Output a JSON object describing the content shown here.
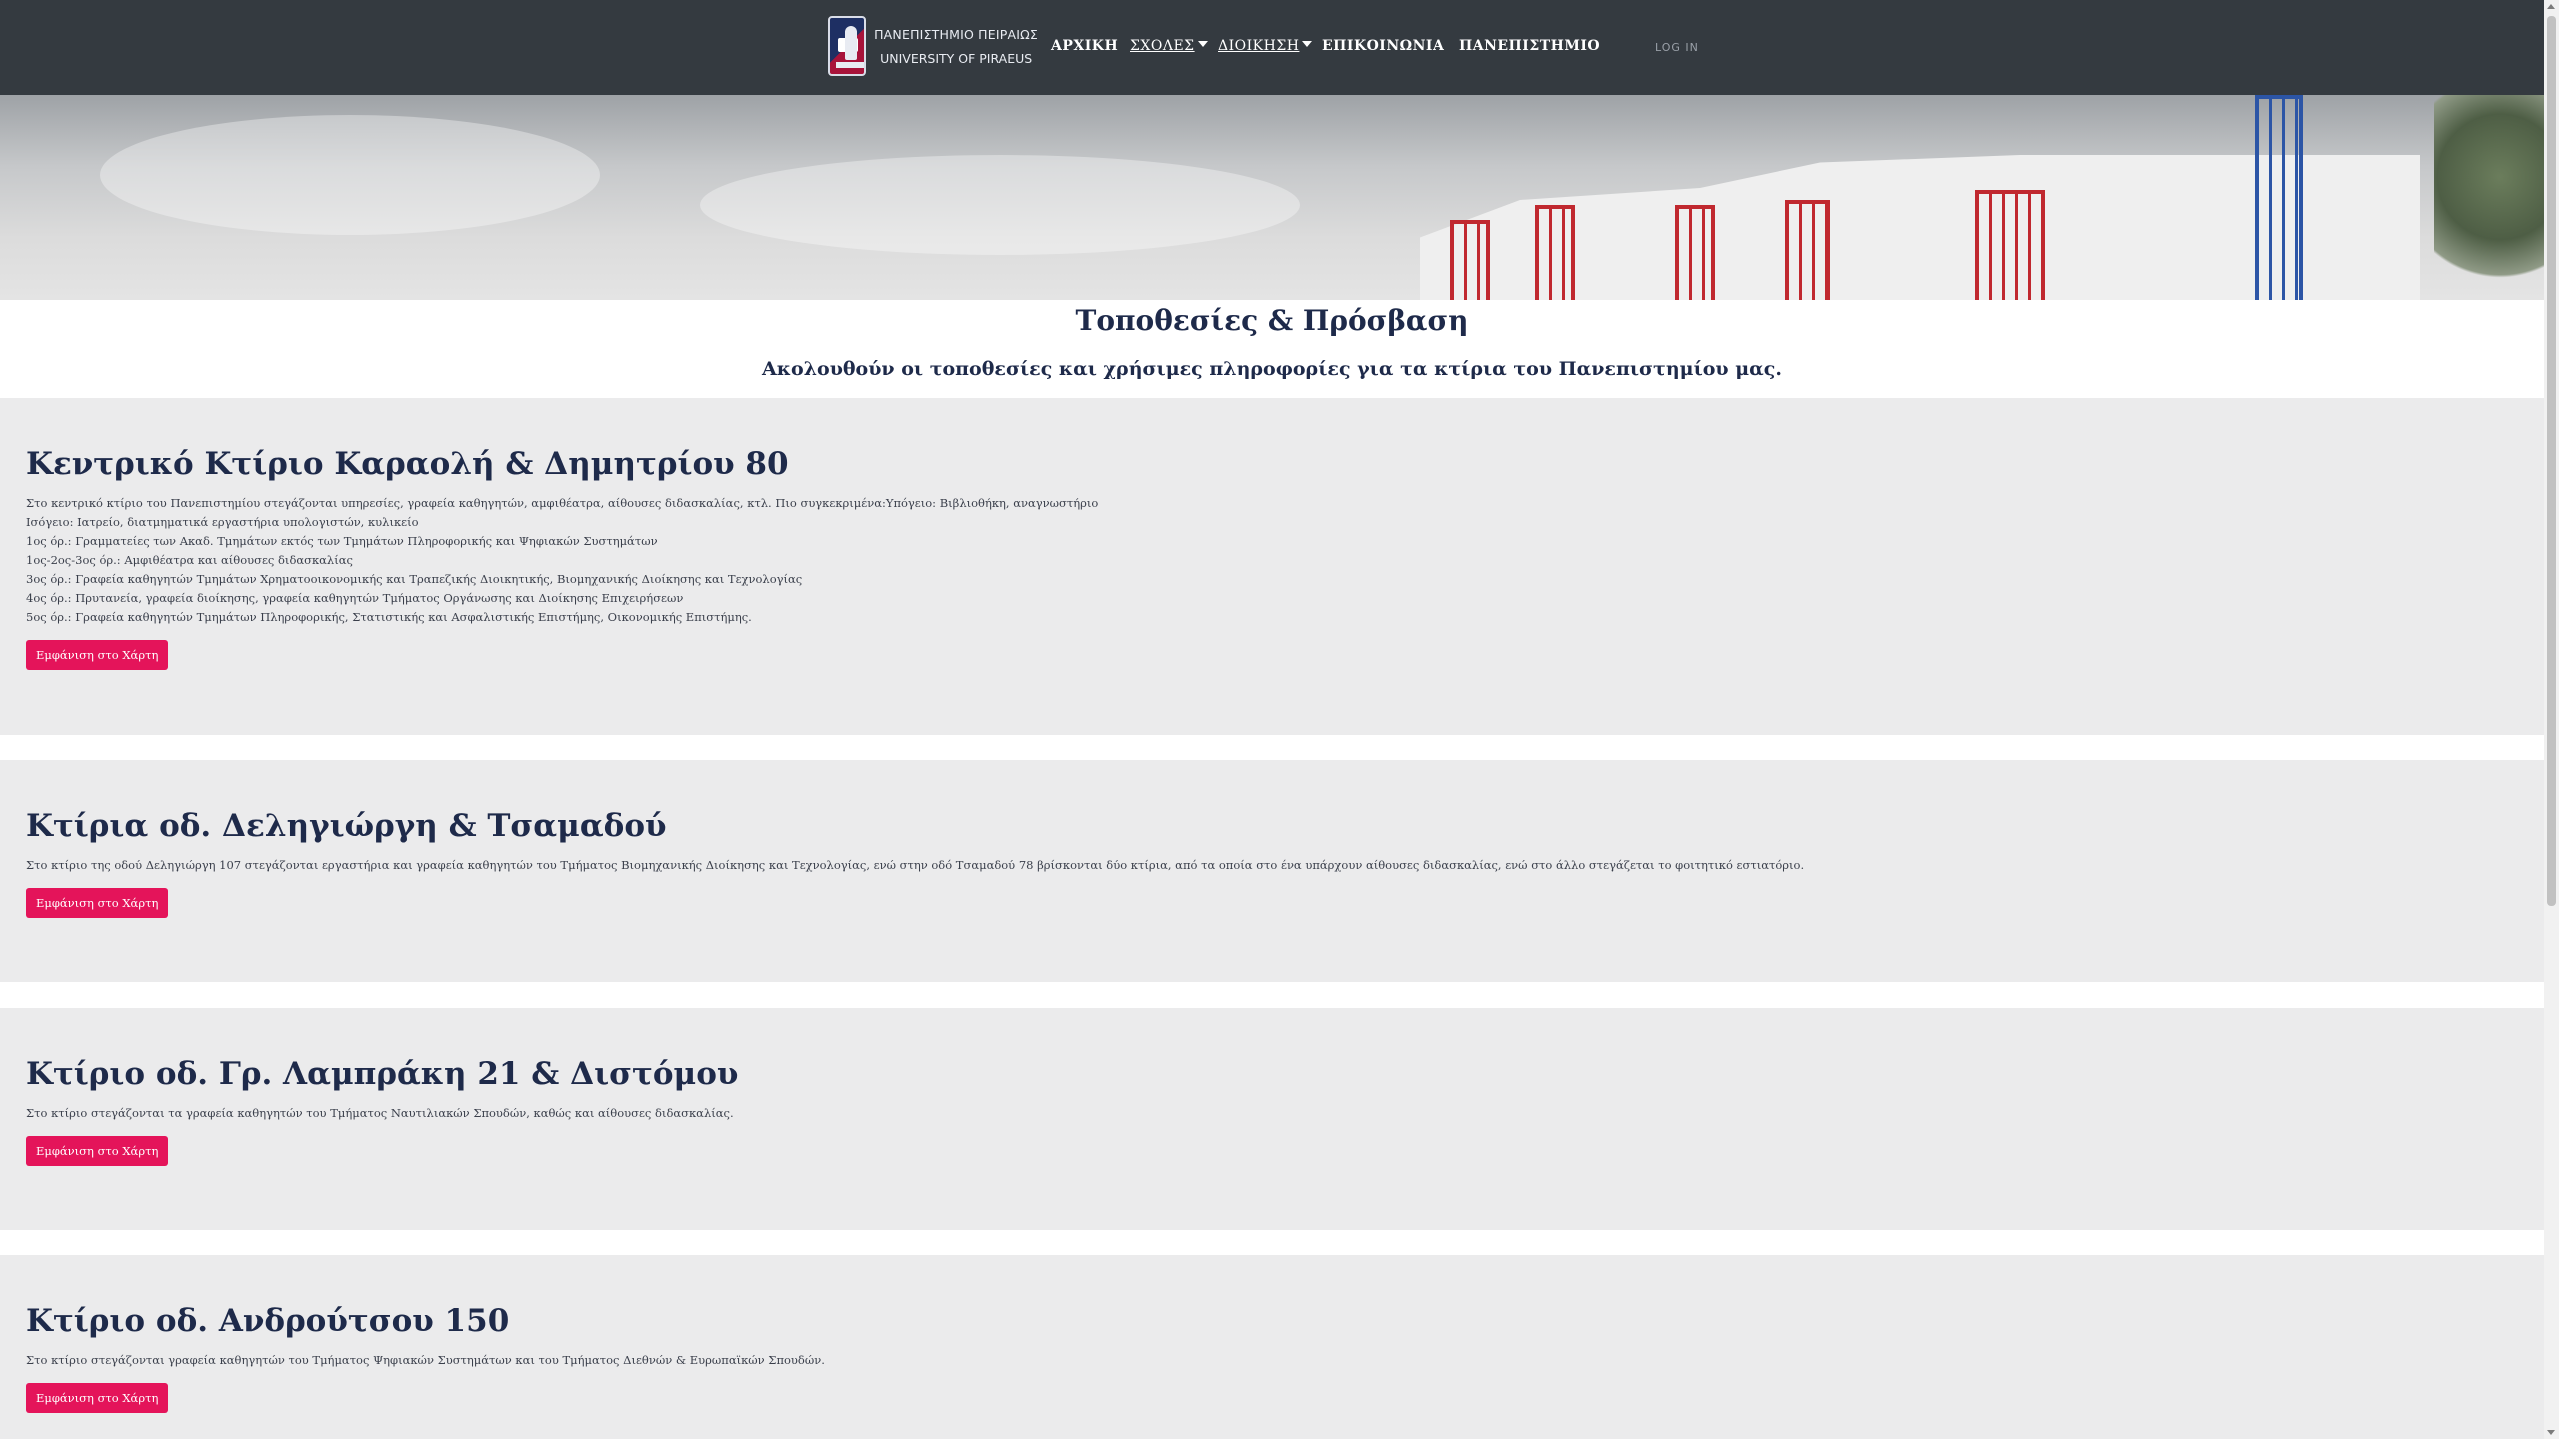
{
  "brand": {
    "name_greek": "ΠΑΝΕΠΙΣΤΗΜΙΟ ΠΕΙΡΑΙΩΣ",
    "name_english": "UNIVERSITY OF PIRAEUS"
  },
  "nav": {
    "home": "ΑΡΧΙΚΗ",
    "schools": "ΣΧΟΛΕΣ",
    "administration": "ΔΙΟΙΚΗΣΗ",
    "contact": "ΕΠΙΚΟΙΝΩΝΙΑ",
    "university": "ΠΑΝΕΠΙΣΤΗΜΙΟ",
    "login": "LOG IN"
  },
  "page": {
    "title": "Τοποθεσίες & Πρόσβαση",
    "subtitle": "Ακολουθούν οι τοποθεσίες και χρήσιμες πληροφορίες για τα κτίρια του Πανεπιστημίου μας."
  },
  "buildings": [
    {
      "title": "Κεντρικό Κτίριο Καραολή & Δημητρίου 80",
      "lines": [
        "Στο κεντρικό κτίριο του Πανεπιστημίου στεγάζονται υπηρεσίες, γραφεία καθηγητών, αμφιθέατρα, αίθουσες διδασκαλίας, κτλ. Πιο συγκεκριμένα:Υπόγειο: Βιβλιοθήκη, αναγνωστήριο",
        "Ισόγειο: Ιατρείο, διατμηματικά εργαστήρια υπολογιστών, κυλικείο",
        "1ος όρ.: Γραμματείες των Ακαδ. Τμημάτων εκτός των Τμημάτων Πληροφορικής και Ψηφιακών Συστημάτων",
        "1ος-2ος-3ος όρ.: Αμφιθέατρα και αίθουσες διδασκαλίας",
        "3ος όρ.: Γραφεία καθηγητών Τμημάτων Χρηματοοικονομικής και Τραπεζικής Διοικητικής, Βιομηχανικής Διοίκησης και Τεχνολογίας",
        "4ος όρ.: Πρυτανεία, γραφεία διοίκησης, γραφεία καθηγητών Τμήματος Οργάνωσης και Διοίκησης Επιχειρήσεων",
        "5ος όρ.: Γραφεία καθηγητών Τμημάτων Πληροφορικής, Στατιστικής και Ασφαλιστικής Επιστήμης, Οικονομικής Επιστήμης."
      ],
      "button": "Εμφάνιση στο Χάρτη"
    },
    {
      "title": "Κτίρια οδ. Δεληγιώργη & Τσαμαδού",
      "lines": [
        "Στο κτίριο της οδού Δεληγιώργη 107 στεγάζονται εργαστήρια και γραφεία καθηγητών του Τμήματος Βιομηχανικής Διοίκησης και Τεχνολογίας, ενώ στην οδό Τσαμαδού 78 βρίσκονται δύο κτίρια, από τα οποία στο ένα υπάρχουν αίθουσες διδασκαλίας, ενώ στο άλλο στεγάζεται το φοιτητικό εστιατόριο."
      ],
      "button": "Εμφάνιση στο Χάρτη"
    },
    {
      "title": "Κτίριο οδ. Γρ. Λαμπράκη 21 & Διστόμου",
      "lines": [
        "Στο κτίριο στεγάζονται τα γραφεία καθηγητών του Τμήματος Ναυτιλιακών Σπουδών, καθώς και αίθουσες διδασκαλίας."
      ],
      "button": "Εμφάνιση στο Χάρτη"
    },
    {
      "title": "Κτίριο οδ. Ανδρούτσου 150",
      "lines": [
        "Στο κτίριο στεγάζονται γραφεία καθηγητών του Τμήματος Ψηφιακών Συστημάτων και του Τμήματος Διεθνών & Ευρωπαϊκών Σπουδών."
      ],
      "button": "Εμφάνιση στο Χάρτη"
    }
  ],
  "colors": {
    "navbar": "#343a40",
    "accent": "#e4145a",
    "heading": "#1e2a4a",
    "card_bg": "#ebebec"
  }
}
